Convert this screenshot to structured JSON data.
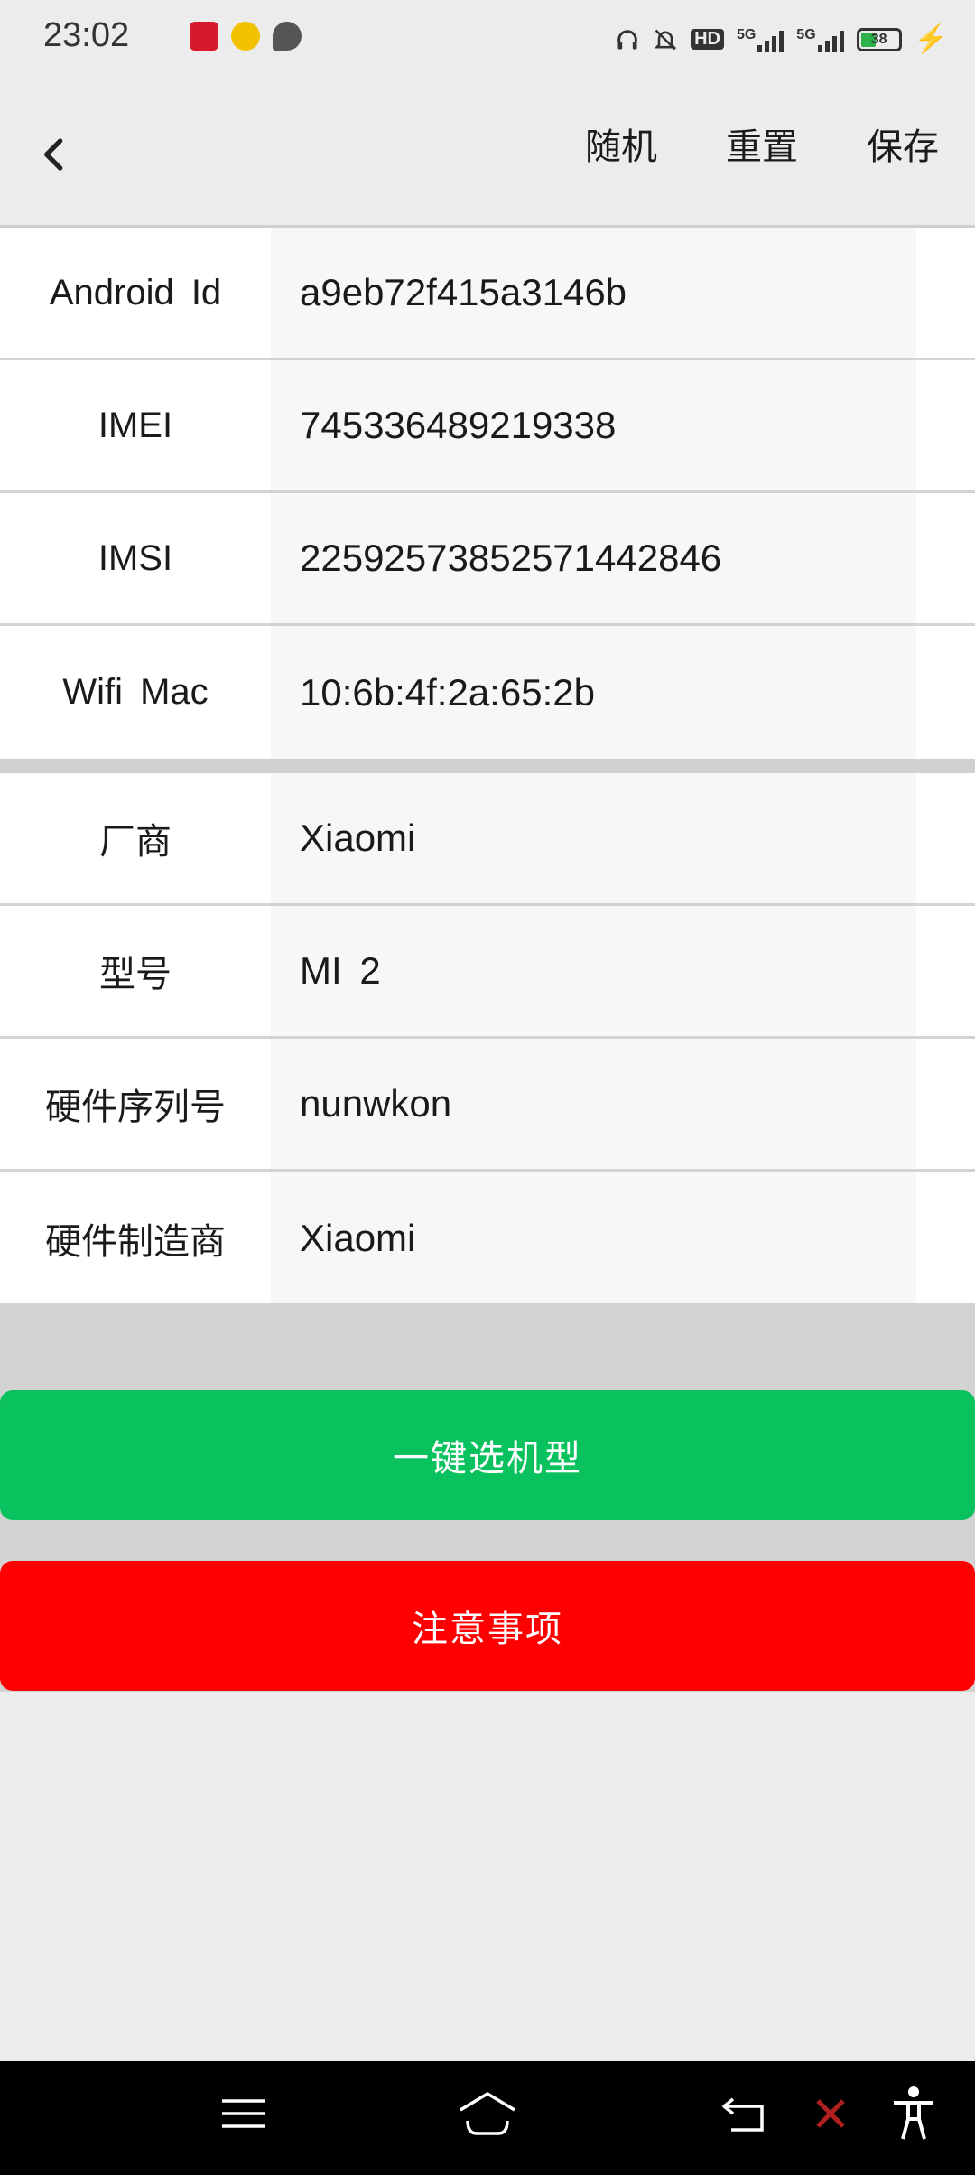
{
  "status": {
    "time": "23:02",
    "network1": "HD",
    "network2": "5G",
    "network3": "5G",
    "battery": "38"
  },
  "header": {
    "random_label": "随机",
    "reset_label": "重置",
    "save_label": "保存"
  },
  "device_ids": [
    {
      "label": "Android Id",
      "value": "a9eb72f415a3146b"
    },
    {
      "label": "IMEI",
      "value": "745336489219338"
    },
    {
      "label": "IMSI",
      "value": "2259257385257144284​6"
    },
    {
      "label": "Wifi Mac",
      "value": "10:6b:4f:2a:65:2b"
    }
  ],
  "device_info": [
    {
      "label": "厂商",
      "value": "Xiaomi"
    },
    {
      "label": "型号",
      "value": "MI 2"
    },
    {
      "label": "硬件序列号",
      "value": "nunwkon"
    },
    {
      "label": "硬件制造商",
      "value": "Xiaomi"
    }
  ],
  "buttons": {
    "select_model": "一键选机型",
    "notes": "注意事项"
  },
  "colors": {
    "green_button": "#09c25e",
    "red_button": "#ff0000"
  }
}
